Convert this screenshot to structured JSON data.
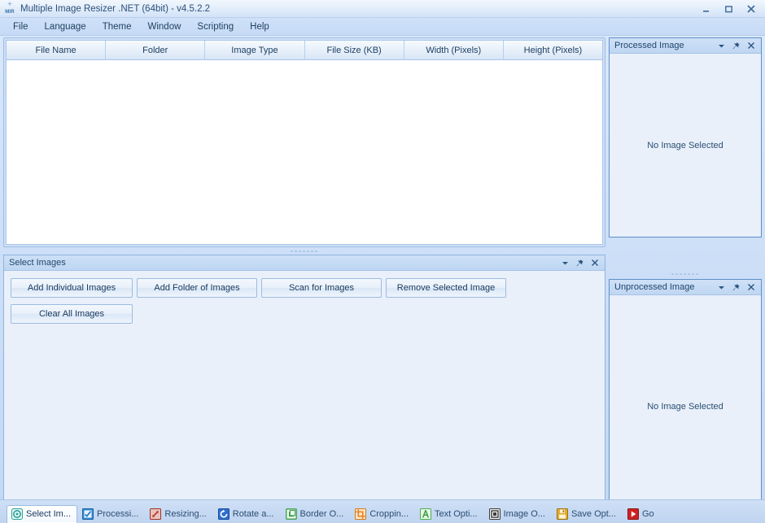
{
  "window": {
    "title": "Multiple Image Resizer .NET (64bit) - v4.5.2.2",
    "app_icon": "mir-logo-icon",
    "controls": {
      "minimize": "minimize-icon",
      "maximize": "maximize-icon",
      "close": "close-icon"
    }
  },
  "menubar": {
    "items": [
      {
        "label": "File"
      },
      {
        "label": "Language"
      },
      {
        "label": "Theme"
      },
      {
        "label": "Window"
      },
      {
        "label": "Scripting"
      },
      {
        "label": "Help"
      }
    ]
  },
  "file_table": {
    "columns": [
      "File Name",
      "Folder",
      "Image Type",
      "File Size (KB)",
      "Width (Pixels)",
      "Height (Pixels)"
    ],
    "rows": []
  },
  "select_images_panel": {
    "title": "Select Images",
    "caption_buttons": {
      "dropdown": "chevron-down-icon",
      "pin": "pin-icon",
      "close": "close-icon"
    },
    "buttons": [
      {
        "label": "Add Individual Images"
      },
      {
        "label": "Add Folder of Images"
      },
      {
        "label": "Scan for Images"
      },
      {
        "label": "Remove Selected Image"
      },
      {
        "label": "Clear All Images"
      }
    ]
  },
  "processed_panel": {
    "title": "Processed Image",
    "empty_text": "No Image Selected",
    "caption_buttons": {
      "dropdown": "chevron-down-icon",
      "pin": "pin-icon",
      "close": "close-icon"
    }
  },
  "unprocessed_panel": {
    "title": "Unprocessed Image",
    "empty_text": "No Image Selected",
    "caption_buttons": {
      "dropdown": "chevron-down-icon",
      "pin": "pin-icon",
      "close": "close-icon"
    }
  },
  "tabs": [
    {
      "label": "Select Im...",
      "icon": "select-images-icon",
      "color": "#2aa39a",
      "active": true
    },
    {
      "label": "Processi...",
      "icon": "processing-options-icon",
      "color": "#1f77c9",
      "active": false
    },
    {
      "label": "Resizing...",
      "icon": "resizing-icon",
      "color": "#c0392b",
      "active": false
    },
    {
      "label": "Rotate a...",
      "icon": "rotate-icon",
      "color": "#1f5fbf",
      "active": false
    },
    {
      "label": "Border O...",
      "icon": "border-options-icon",
      "color": "#3a9d4a",
      "active": false
    },
    {
      "label": "Croppin...",
      "icon": "cropping-icon",
      "color": "#e8862a",
      "active": false
    },
    {
      "label": "Text Opti...",
      "icon": "text-options-icon",
      "color": "#4caf50",
      "active": false
    },
    {
      "label": "Image O...",
      "icon": "image-options-icon",
      "color": "#3c3c3c",
      "active": false
    },
    {
      "label": "Save Opt...",
      "icon": "save-options-icon",
      "color": "#d9a328",
      "active": false
    },
    {
      "label": "Go",
      "icon": "go-play-icon",
      "color": "#cc2222",
      "active": false
    }
  ],
  "theme": {
    "accent": "#5f8fc9",
    "panel_bg": "#e9f0fa",
    "caption_bg": "#cde0f6",
    "text": "#1b3a5c"
  }
}
